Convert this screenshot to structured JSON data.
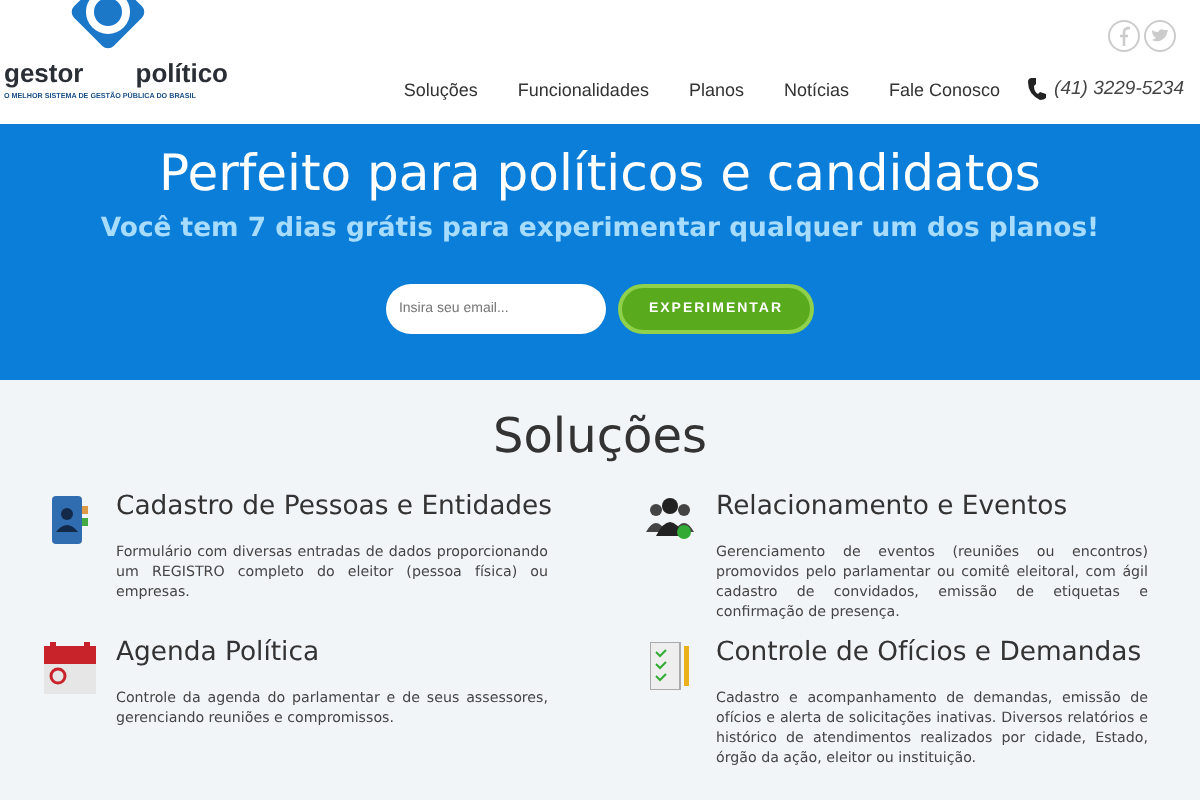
{
  "logo": {
    "left_word": "gestor",
    "right_word": "político",
    "tagline": "O MELHOR SISTEMA DE GESTÃO PÚBLICA DO BRASIL"
  },
  "nav": [
    "Soluções",
    "Funcionalidades",
    "Planos",
    "Notícias",
    "Fale Conosco"
  ],
  "phone": "(41) 3229-5234",
  "hero": {
    "title": "Perfeito para políticos e candidatos",
    "subtitle": "Você tem 7 dias grátis para experimentar qualquer um dos planos!",
    "email_placeholder": "Insira seu email...",
    "button": "EXPERIMENTAR"
  },
  "solutions": {
    "heading": "Soluções",
    "items": [
      {
        "kind": "contacts",
        "title": "Cadastro de Pessoas e Entidades",
        "text": "Formulário com diversas entradas de dados proporcionando um REGISTRO completo do eleitor (pessoa física) ou empresas."
      },
      {
        "kind": "people",
        "title": "Relacionamento e Eventos",
        "text": "Gerenciamento de eventos (reuniões ou encontros) promovidos pelo parlamentar ou comitê eleitoral, com ágil cadastro de convidados, emissão de etiquetas e confirmação de presença."
      },
      {
        "kind": "calendar",
        "title": "Agenda Política",
        "text": "Controle da agenda do parlamentar e de seus assessores, gerenciando reuniões e compromissos."
      },
      {
        "kind": "checklist",
        "title": "Controle de Ofícios e Demandas",
        "text": "Cadastro e acompanhamento de demandas, emissão de ofícios e alerta de solicitações inativas. Diversos relatórios e histórico de atendimentos realizados por cidade, Estado, órgão da ação, eleitor ou instituição."
      }
    ]
  }
}
